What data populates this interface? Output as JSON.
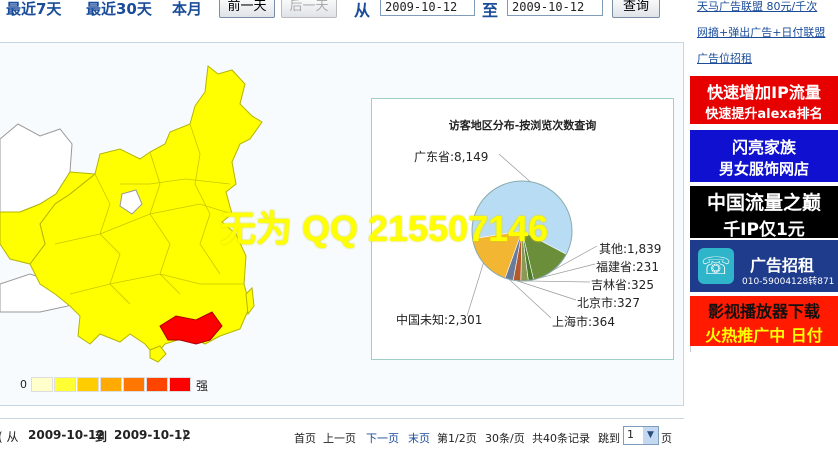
{
  "toolbar": {
    "last7": "最近7天",
    "last30": "最近30天",
    "month": "本月",
    "prev_day": "前一天",
    "next_day": "后一天",
    "from_label": "从",
    "to_label": "至",
    "from_date": "2009-10-12",
    "to_date": "2009-10-12",
    "query": "查询"
  },
  "watermark": "无为 QQ 215507146",
  "legend": {
    "low": "0",
    "high": "强",
    "colors": [
      "#ffffcc",
      "#ffff33",
      "#ffcc00",
      "#ffaa00",
      "#ff7700",
      "#ff4400",
      "#ff0000"
    ]
  },
  "map": {
    "fill": "#ffff00",
    "highlight": "#ff0000",
    "unvisited": "#ffffff"
  },
  "chart_data": {
    "type": "pie",
    "title": "访客地区分布-按浏览次数查询",
    "slices": [
      {
        "label": "广东省",
        "value": 8149,
        "text": "广东省:8,149",
        "color": "#b9dcf5"
      },
      {
        "label": "其他",
        "value": 1839,
        "text": "其他:1,839",
        "color": "#6b8e3a"
      },
      {
        "label": "福建省",
        "value": 231,
        "text": "福建省:231",
        "color": "#4c7a2a"
      },
      {
        "label": "吉林省",
        "value": 325,
        "text": "吉林省:325",
        "color": "#8a9a55"
      },
      {
        "label": "北京市",
        "value": 327,
        "text": "北京市:327",
        "color": "#b25a2c"
      },
      {
        "label": "上海市",
        "value": 364,
        "text": "上海市:364",
        "color": "#6a7a9a"
      },
      {
        "label": "中国未知",
        "value": 2301,
        "text": "中国未知:2,301",
        "color": "#f2b632"
      }
    ]
  },
  "footer": {
    "range_prefix": "( 从",
    "range_from": "2009-10-12",
    "range_to_word": "到",
    "range_to": "2009-10-12",
    "range_suffix": ")",
    "first": "首页",
    "prev": "上一页",
    "next": "下一页",
    "last": "末页",
    "page_info": "第1/2页",
    "per_page": "30条/页",
    "total": "共40条记录",
    "jump": "跳到",
    "page_value": "1",
    "page_unit": "页"
  },
  "ads": {
    "link1": "天马广告联盟 80元/千次",
    "link2": "网摘+弹出广告+日付联盟",
    "link3": "广告位招租",
    "banner1_line1": "快速增加IP流量",
    "banner1_line2": "快速提升alexa排名",
    "banner2_line1": "闪亮家族",
    "banner2_line2": "男女服饰网店",
    "banner3_line1": "中国流量之巅",
    "banner3_line2": "千IP仅1元",
    "banner4_title": "广告招租",
    "banner4_phone": "010-59004128转871",
    "banner5_line1": "影视播放器下载",
    "banner5_line2": "火热推广中 日付"
  }
}
